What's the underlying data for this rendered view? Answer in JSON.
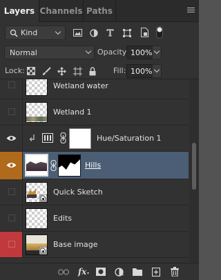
{
  "tabs": [
    {
      "label": "Layers",
      "active": true
    },
    {
      "label": "Channels",
      "active": false
    },
    {
      "label": "Paths",
      "active": false
    }
  ],
  "filter": {
    "kind_label": "Kind",
    "filter_icons": [
      "pixel-filter-icon",
      "adjustment-filter-icon",
      "type-filter-icon",
      "shape-filter-icon",
      "smart-object-filter-icon",
      "filter-toggle-icon"
    ]
  },
  "blend": {
    "mode": "Normal",
    "opacity_label": "Opacity:",
    "opacity_value": "100%"
  },
  "lock": {
    "label": "Lock:",
    "fill_label": "Fill:",
    "fill_value": "100%"
  },
  "layers": [
    {
      "name": "Wetland water",
      "visible": false,
      "type": "pixel"
    },
    {
      "name": "Wetland 1",
      "visible": false,
      "type": "pixel"
    },
    {
      "name": "Hue/Saturation 1",
      "visible": true,
      "type": "adjustment",
      "clipped": true
    },
    {
      "name": "Hills",
      "visible": true,
      "type": "pixel-with-mask",
      "selected": true
    },
    {
      "name": "Quick Sketch",
      "visible": false,
      "type": "smart-object"
    },
    {
      "name": "Edits",
      "visible": false,
      "type": "pixel"
    },
    {
      "name": "Base image",
      "visible": false,
      "type": "smart-object"
    }
  ],
  "colors": {
    "panel_bg": "#323232",
    "selected_row": "#4b5e75",
    "eye_highlight_orange": "#b06a1c",
    "eye_highlight_red": "#c0393c"
  },
  "footer_icons": [
    "link-layers-icon",
    "fx-icon",
    "add-mask-icon",
    "adjustment-layer-icon",
    "new-group-icon",
    "new-layer-icon",
    "delete-layer-icon"
  ]
}
